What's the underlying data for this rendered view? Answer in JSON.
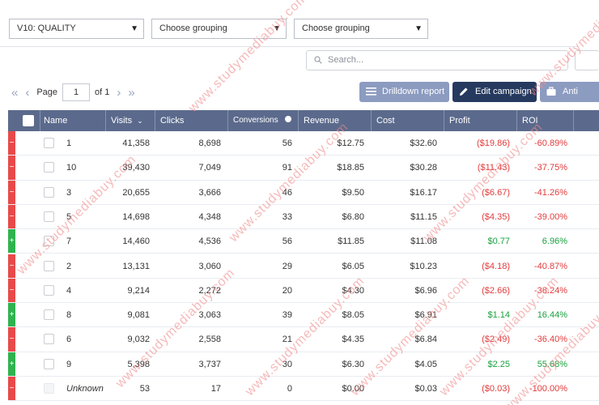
{
  "filters": {
    "version_select": "V10: QUALITY",
    "grouping_1": "Choose grouping",
    "grouping_2": "Choose grouping"
  },
  "search": {
    "placeholder": "Search..."
  },
  "pager": {
    "page_label": "Page",
    "page_value": "1",
    "of_label": "of 1"
  },
  "toolbar": {
    "drilldown_label": "Drilldown report",
    "edit_label": "Edit campaign",
    "anti_label": "Anti"
  },
  "columns": {
    "name": "Name",
    "visits": "Visits",
    "clicks": "Clicks",
    "conversions": "Conversions",
    "revenue": "Revenue",
    "cost": "Cost",
    "profit": "Profit",
    "roi": "ROI"
  },
  "rows": [
    {
      "status": "neg",
      "badge": "−",
      "name": "1",
      "visits": "41,358",
      "clicks": "8,698",
      "conversions": "56",
      "revenue": "$12.75",
      "cost": "$32.60",
      "profit": "($19.86)",
      "roi": "-60.89%"
    },
    {
      "status": "neg",
      "badge": "−",
      "name": "10",
      "visits": "39,430",
      "clicks": "7,049",
      "conversions": "91",
      "revenue": "$18.85",
      "cost": "$30.28",
      "profit": "($11.43)",
      "roi": "-37.75%"
    },
    {
      "status": "neg",
      "badge": "−",
      "name": "3",
      "visits": "20,655",
      "clicks": "3,666",
      "conversions": "46",
      "revenue": "$9.50",
      "cost": "$16.17",
      "profit": "($6.67)",
      "roi": "-41.26%"
    },
    {
      "status": "neg",
      "badge": "−",
      "name": "5",
      "visits": "14,698",
      "clicks": "4,348",
      "conversions": "33",
      "revenue": "$6.80",
      "cost": "$11.15",
      "profit": "($4.35)",
      "roi": "-39.00%"
    },
    {
      "status": "pos",
      "badge": "+",
      "name": "7",
      "visits": "14,460",
      "clicks": "4,536",
      "conversions": "56",
      "revenue": "$11.85",
      "cost": "$11.08",
      "profit": "$0.77",
      "roi": "6.96%"
    },
    {
      "status": "neg",
      "badge": "−",
      "name": "2",
      "visits": "13,131",
      "clicks": "3,060",
      "conversions": "29",
      "revenue": "$6.05",
      "cost": "$10.23",
      "profit": "($4.18)",
      "roi": "-40.87%"
    },
    {
      "status": "neg",
      "badge": "−",
      "name": "4",
      "visits": "9,214",
      "clicks": "2,272",
      "conversions": "20",
      "revenue": "$4.30",
      "cost": "$6.96",
      "profit": "($2.66)",
      "roi": "-38.24%"
    },
    {
      "status": "pos",
      "badge": "+",
      "name": "8",
      "visits": "9,081",
      "clicks": "3,063",
      "conversions": "39",
      "revenue": "$8.05",
      "cost": "$6.91",
      "profit": "$1.14",
      "roi": "16.44%"
    },
    {
      "status": "neg",
      "badge": "−",
      "name": "6",
      "visits": "9,032",
      "clicks": "2,558",
      "conversions": "21",
      "revenue": "$4.35",
      "cost": "$6.84",
      "profit": "($2.49)",
      "roi": "-36.40%"
    },
    {
      "status": "pos",
      "badge": "+",
      "name": "9",
      "visits": "5,398",
      "clicks": "3,737",
      "conversions": "30",
      "revenue": "$6.30",
      "cost": "$4.05",
      "profit": "$2.25",
      "roi": "55.68%"
    },
    {
      "status": "unk",
      "badge": "−",
      "name": "Unknown",
      "visits": "53",
      "clicks": "17",
      "conversions": "0",
      "revenue": "$0.00",
      "cost": "$0.03",
      "profit": "($0.03)",
      "roi": "-100.00%"
    }
  ],
  "watermark": "www.studymediabuy.com",
  "colors": {
    "header_bg": "#5b6a8c",
    "negative": "#e84a4a",
    "positive": "#2fb34f",
    "edit_button": "#26395f"
  }
}
